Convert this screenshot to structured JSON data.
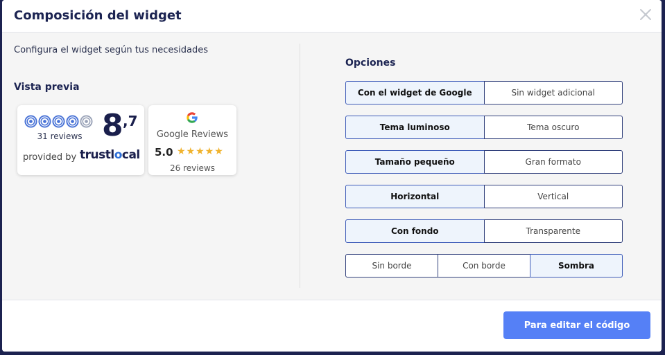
{
  "modal": {
    "title": "Composición del widget",
    "close_icon": "close-icon"
  },
  "left": {
    "subtitle": "Configura el widget según tus necesidades",
    "preview_title": "Vista previa"
  },
  "trustlocal_widget": {
    "rating_icon": "trustlocal-rating-circles-icon",
    "reviews_count": "31 reviews",
    "score_main": "8",
    "score_decimal": ",7",
    "provided_by": "provided by",
    "logo_text_a": "trustl",
    "logo_text_b": "o",
    "logo_text_c": "cal"
  },
  "google_widget": {
    "logo_icon": "google-g-icon",
    "name": "Google Reviews",
    "rating": "5.0",
    "stars": "★★★★★",
    "reviews_count": "26 reviews"
  },
  "options": {
    "title": "Opciones",
    "groups": [
      {
        "items": [
          {
            "label": "Con el widget de Google",
            "selected": true
          },
          {
            "label": "Sin widget adicional",
            "selected": false
          }
        ]
      },
      {
        "items": [
          {
            "label": "Tema luminoso",
            "selected": true
          },
          {
            "label": "Tema oscuro",
            "selected": false
          }
        ]
      },
      {
        "items": [
          {
            "label": "Tamaño pequeño",
            "selected": true
          },
          {
            "label": "Gran formato",
            "selected": false
          }
        ]
      },
      {
        "items": [
          {
            "label": "Horizontal",
            "selected": true
          },
          {
            "label": "Vertical",
            "selected": false
          }
        ]
      },
      {
        "items": [
          {
            "label": "Con fondo",
            "selected": true
          },
          {
            "label": "Transparente",
            "selected": false
          }
        ]
      },
      {
        "items": [
          {
            "label": "Sin borde",
            "selected": false
          },
          {
            "label": "Con borde",
            "selected": false
          },
          {
            "label": "Sombra",
            "selected": true
          }
        ]
      }
    ]
  },
  "footer": {
    "cta_label": "Para editar el código"
  },
  "colors": {
    "primary_navy": "#1c2452",
    "accent_blue": "#5580f6",
    "selected_bg": "#eef4fc",
    "star_yellow": "#f0b32e"
  }
}
